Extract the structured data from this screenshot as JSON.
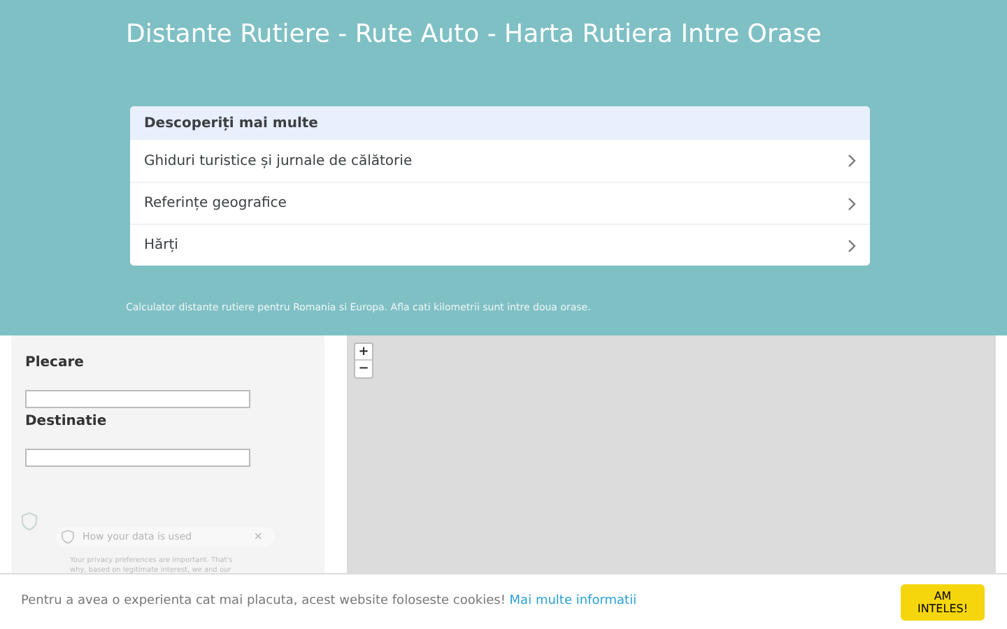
{
  "header": {
    "title": "Distante Rutiere - Rute Auto - Harta Rutiera Intre Orase",
    "subtitle": "Calculator distante rutiere pentru Romania si Europa. Afla cati kilometrii sunt intre doua orase."
  },
  "discover": {
    "title": "Descoperiți mai multe",
    "items": [
      {
        "label": "Ghiduri turistice și jurnale de călătorie"
      },
      {
        "label": "Referințe geografice"
      },
      {
        "label": "Hărți"
      }
    ]
  },
  "form": {
    "fields": [
      {
        "label": "Plecare"
      },
      {
        "label": "Destinatie"
      }
    ]
  },
  "map": {
    "zoom_in": "+",
    "zoom_out": "−"
  },
  "privacy_popup": {
    "title": "How your data is used",
    "close": "×",
    "lines": [
      "Your privacy preferences are important. That's",
      "why, based on legitimate interest, we and our"
    ]
  },
  "cookie_bar": {
    "message": "Pentru a avea o experienta cat mai placuta, acest website foloseste cookies!",
    "link": "Mai multe informatii",
    "button": "AM INTELES!"
  }
}
